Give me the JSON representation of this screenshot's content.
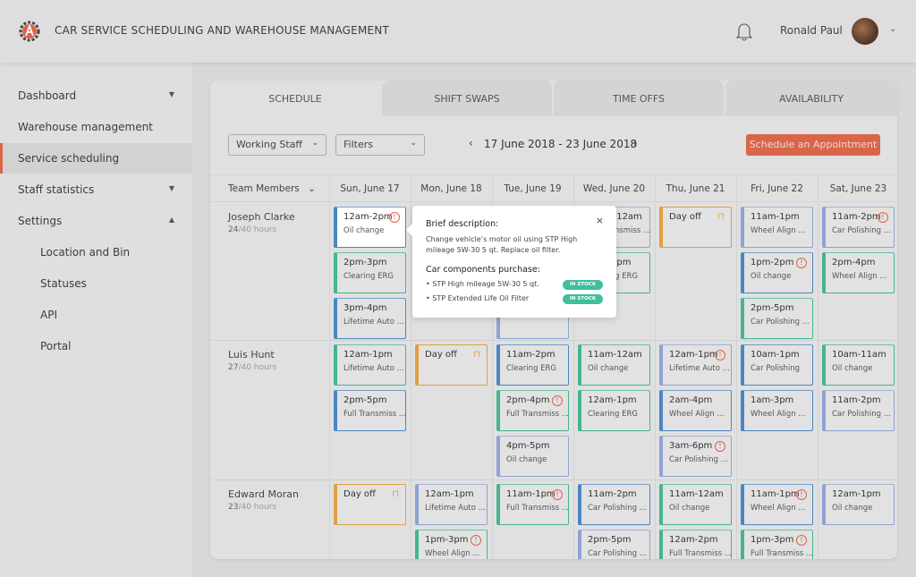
{
  "header": {
    "title": "CAR SERVICE SCHEDULING AND WAREHOUSE MANAGEMENT",
    "user_name": "Ronald Paul"
  },
  "colors": {
    "accent": "#d9654a",
    "blue": "#4a86c0",
    "teal": "#45b394",
    "periwinkle": "#8ea2d4",
    "orange": "#e0a040",
    "badge": "#3fbf9c"
  },
  "sidebar": {
    "items": [
      {
        "label": "Dashboard",
        "caret": "▼"
      },
      {
        "label": "Warehouse management"
      },
      {
        "label": "Service scheduling",
        "active": true
      },
      {
        "label": "Staff statistics",
        "caret": "▼"
      },
      {
        "label": "Settings",
        "caret": "▲"
      },
      {
        "label": "Location and Bin",
        "sub": true
      },
      {
        "label": "Statuses",
        "sub": true
      },
      {
        "label": "API",
        "sub": true
      },
      {
        "label": "Portal",
        "sub": true
      }
    ]
  },
  "tabs": [
    {
      "label": "SCHEDULE",
      "active": true
    },
    {
      "label": "SHIFT SWAPS"
    },
    {
      "label": "TIME OFFS"
    },
    {
      "label": "AVAILABILITY"
    }
  ],
  "toolbar": {
    "staff_select": "Working Staff",
    "filters_select": "Filters",
    "date_range": "17 June 2018 - 23 June 2018",
    "prev": "‹",
    "next": "›",
    "cta": "Schedule an Appointment"
  },
  "grid": {
    "team_header": "Team Members",
    "days": [
      "Sun, June 17",
      "Mon, June 18",
      "Tue, June 19",
      "Wed, June 20",
      "Thu, June 21",
      "Fri, June 22",
      "Sat, June 23"
    ]
  },
  "members": [
    {
      "name": "Joseph Clarke",
      "hours": "24",
      "total": "/40 hours",
      "days": [
        [
          {
            "time": "12am-2pm",
            "desc": "Oil change",
            "color": "blue",
            "warn": true,
            "selected": true
          },
          {
            "time": "2pm-3pm",
            "desc": "Clearing ERG",
            "color": "teal"
          },
          {
            "time": "3pm-4pm",
            "desc": "Lifetime Auto ...",
            "color": "blue"
          }
        ],
        [],
        [
          {
            "time": "",
            "desc": "",
            "color": "blue"
          },
          {
            "time": "",
            "desc": "",
            "color": "teal"
          },
          {
            "time": "",
            "desc": "Oil change",
            "color": "periwinkle"
          }
        ],
        [
          {
            "time": "11am-12am",
            "desc": "Full Transmiss ...",
            "color": "periwinkle"
          },
          {
            "time": "1pm-3pm",
            "desc": "Clearing ERG",
            "color": "teal"
          }
        ],
        [
          {
            "dayoff": true,
            "time": "Day off",
            "color": "orange"
          }
        ],
        [
          {
            "time": "11am-1pm",
            "desc": "Wheel Align ...",
            "color": "periwinkle"
          },
          {
            "time": "1pm-2pm",
            "desc": "Oil change",
            "color": "blue",
            "warn": true
          },
          {
            "time": "2pm-5pm",
            "desc": "Car Polishing ...",
            "color": "teal"
          }
        ],
        [
          {
            "time": "11am-2pm",
            "desc": "Car Polishing ...",
            "color": "periwinkle",
            "warn": true
          },
          {
            "time": "2pm-4pm",
            "desc": "Wheel Align ...",
            "color": "teal"
          }
        ]
      ]
    },
    {
      "name": "Luis Hunt",
      "hours": "27",
      "total": "/40 hours",
      "days": [
        [
          {
            "time": "12am-1pm",
            "desc": "Lifetime Auto ...",
            "color": "teal"
          },
          {
            "time": "2pm-5pm",
            "desc": "Full Transmiss ...",
            "color": "blue"
          }
        ],
        [
          {
            "dayoff": true,
            "time": "Day off",
            "color": "orange"
          }
        ],
        [
          {
            "time": "11am-2pm",
            "desc": "Clearing ERG",
            "color": "blue"
          },
          {
            "time": "2pm-4pm",
            "desc": "Full Transmiss ...",
            "color": "teal",
            "warn": true
          },
          {
            "time": "4pm-5pm",
            "desc": "Oil change",
            "color": "periwinkle"
          }
        ],
        [
          {
            "time": "11am-12am",
            "desc": "Oil change",
            "color": "teal"
          },
          {
            "time": "12am-1pm",
            "desc": "Clearing ERG",
            "color": "teal"
          }
        ],
        [
          {
            "time": "12am-1pm",
            "desc": "Lifetime Auto ...",
            "color": "periwinkle",
            "warn": true
          },
          {
            "time": "2am-4pm",
            "desc": "Wheel Align ...",
            "color": "blue"
          },
          {
            "time": "3am-6pm",
            "desc": "Car Polishing ...",
            "color": "periwinkle",
            "warn": true
          }
        ],
        [
          {
            "time": "10am-1pm",
            "desc": "Car Polishing",
            "color": "blue"
          },
          {
            "time": "1am-3pm",
            "desc": "Wheel Align ...",
            "color": "blue"
          }
        ],
        [
          {
            "time": "10am-11am",
            "desc": "Oil change",
            "color": "teal"
          },
          {
            "time": "11am-2pm",
            "desc": "Car Polishing ...",
            "color": "periwinkle"
          }
        ]
      ]
    },
    {
      "name": "Edward Moran",
      "hours": "23",
      "total": "/40 hours",
      "days": [
        [
          {
            "dayoff": true,
            "time": "Day off",
            "color": "orange"
          }
        ],
        [
          {
            "time": "12am-1pm",
            "desc": "Lifetime Auto ...",
            "color": "periwinkle"
          },
          {
            "time": "1pm-3pm",
            "desc": "Wheel Align ...",
            "color": "teal",
            "warn": true
          }
        ],
        [
          {
            "time": "11am-1pm",
            "desc": "Full Transmiss ...",
            "color": "teal",
            "warn": true
          }
        ],
        [
          {
            "time": "11am-2pm",
            "desc": "Car Polishing ...",
            "color": "blue"
          },
          {
            "time": "2pm-5pm",
            "desc": "Car Polishing ...",
            "color": "periwinkle"
          }
        ],
        [
          {
            "time": "11am-12am",
            "desc": "Oil change",
            "color": "teal"
          },
          {
            "time": "12am-2pm",
            "desc": "Full Transmiss ...",
            "color": "teal"
          }
        ],
        [
          {
            "time": "11am-1pm",
            "desc": "Wheel Align ...",
            "color": "blue",
            "warn": true
          },
          {
            "time": "1pm-3pm",
            "desc": "Full Transmiss ...",
            "color": "teal",
            "warn": true
          }
        ],
        [
          {
            "time": "12am-1pm",
            "desc": "Oil change",
            "color": "periwinkle"
          }
        ]
      ]
    }
  ],
  "popover": {
    "title": "Brief description:",
    "text": "Change vehicle’s motor oil using STP High mileage 5W-30 5 qt. Replace oil filter.",
    "purchase_title": "Car components purchase:",
    "close": "×",
    "items": [
      {
        "name": "• STP High mileage 5W-30 5 qt.",
        "status": "IN STOCK"
      },
      {
        "name": "• STP Extended Life Oil Filter",
        "status": "IN STOCK"
      }
    ]
  }
}
